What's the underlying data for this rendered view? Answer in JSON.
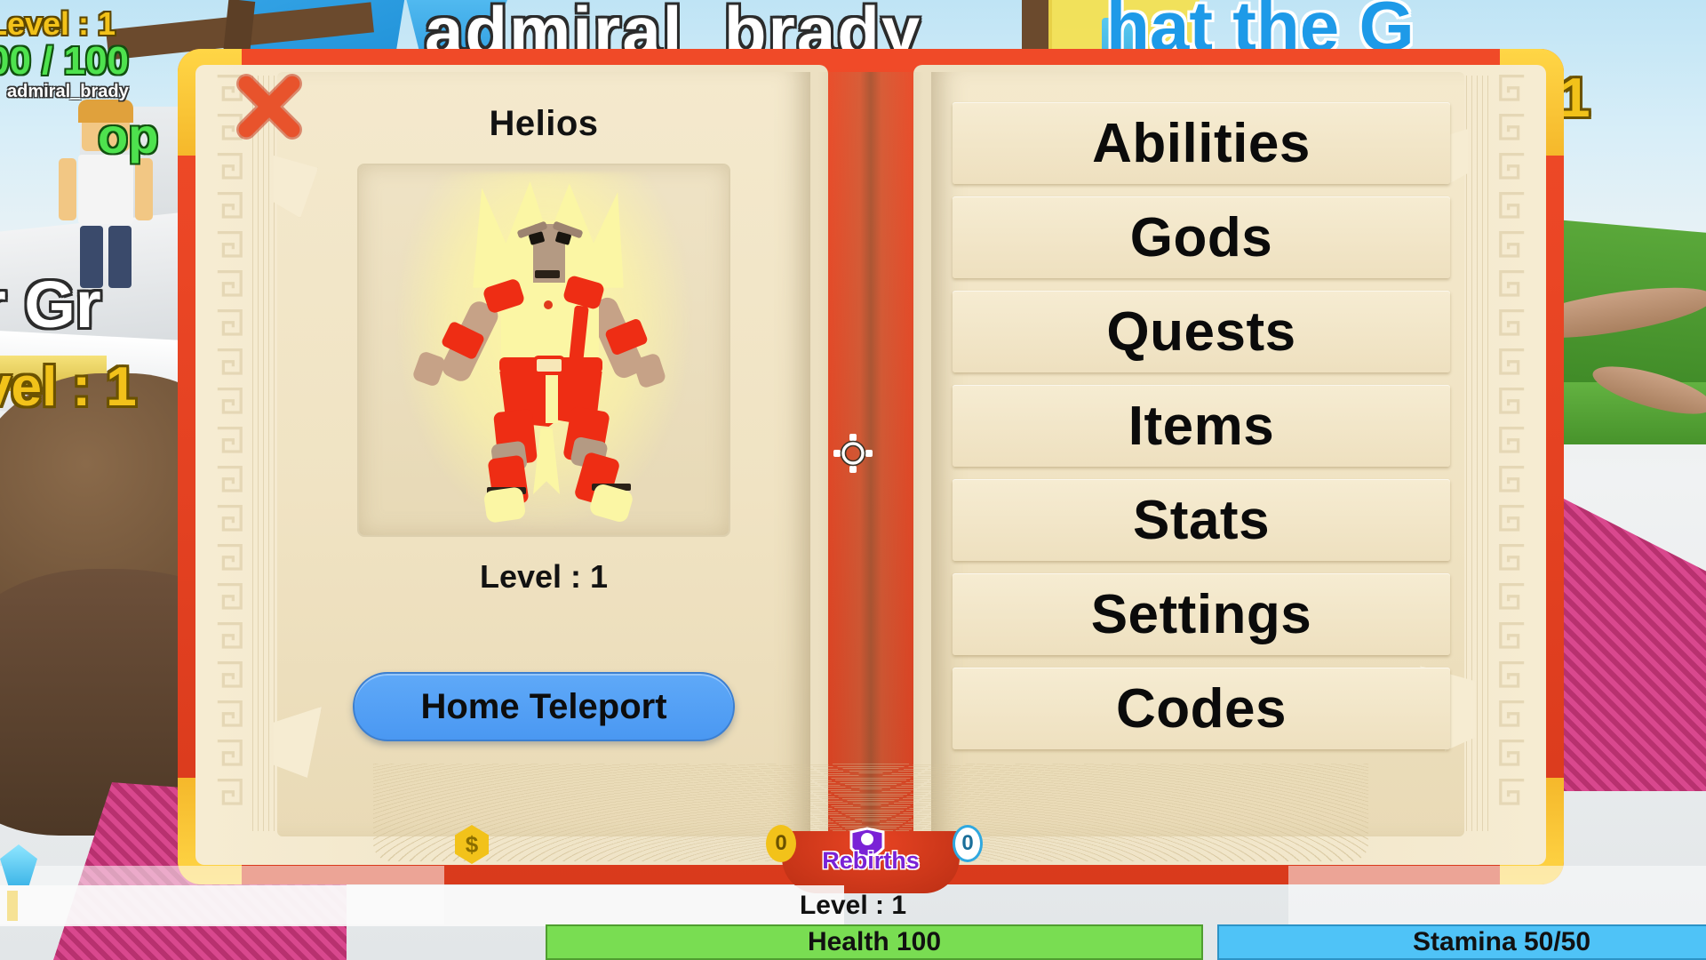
{
  "game": {
    "player_username": "admiral_brady",
    "world_nametags": {
      "center_player": "admiral_brady",
      "blue_text": "hat the G",
      "left_big": "r Gr",
      "left_level": "vel : 1",
      "right_level_number": "1",
      "green_text": "op"
    },
    "top_left_hud": {
      "level": "Level : 1",
      "health": "00 / 100",
      "username": "admiral_brady"
    }
  },
  "book": {
    "close_icon": "close-x-icon",
    "left_page": {
      "god_name": "Helios",
      "portrait_alt": "helios-avatar",
      "level_label": "Level : 1",
      "teleport_button": "Home Teleport"
    },
    "right_page": {
      "menu_items": [
        {
          "label": "Abilities"
        },
        {
          "label": "Gods"
        },
        {
          "label": "Quests"
        },
        {
          "label": "Items"
        },
        {
          "label": "Stats"
        },
        {
          "label": "Settings"
        },
        {
          "label": "Codes"
        }
      ]
    }
  },
  "crosshair": "crosshair-icon",
  "hud": {
    "gold_coin_icon": "gold-coin-icon",
    "coin_count_1": "0",
    "coin_count_2": "0",
    "gem_icon": "gem-icon",
    "rebirth_icon": "rebirth-crown-icon",
    "rebirths_label": "Rebirths",
    "level_label": "Level : 1",
    "health_bar": "Health 100",
    "stamina_bar": "Stamina 50/50"
  },
  "colors": {
    "book_cover_red": "#f04a28",
    "book_gold": "#ffd646",
    "page_cream": "#f4e9cd",
    "teleport_blue": "#5fa9f8",
    "health_green": "#79dd52",
    "stamina_blue": "#4fc3f7",
    "rebirth_purple": "#7a22d6",
    "level_yellow": "#f2c21a"
  }
}
